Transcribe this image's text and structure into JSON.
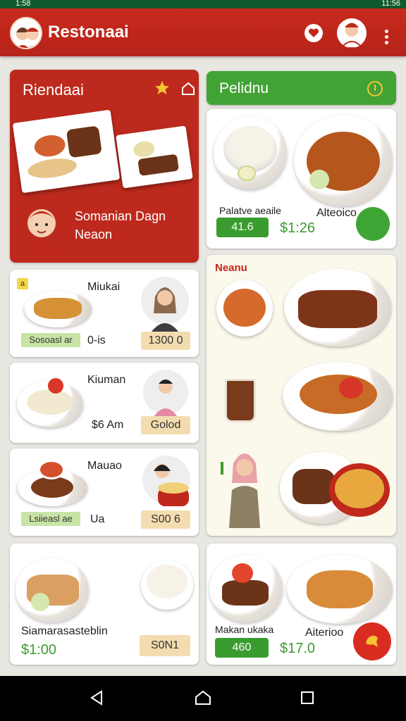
{
  "status": {
    "left": "1:58",
    "right": "11:56"
  },
  "app": {
    "title": "Restonaai"
  },
  "feature": {
    "title": "Riendaai",
    "subtitle_line1": "Somanian Dagn",
    "subtitle_line2": "Neaon"
  },
  "pelidnu": {
    "title": "Pelidnu",
    "left_label": "Palatve aeaile",
    "right_label": "Alteoico",
    "pill": "41.6",
    "price": "$1:26"
  },
  "list": [
    {
      "badge": "a",
      "name": "Miukai",
      "pill": "Sosoasl ar",
      "meta": "0-is",
      "price": "1300 0"
    },
    {
      "name": "Kiuman",
      "meta": "$6 Am",
      "price": "Golod"
    },
    {
      "name": "Mauao",
      "pill": "Lsiieasl ae",
      "meta": "Ua",
      "price": "S00 6"
    }
  ],
  "menu_panel": {
    "title": "Neanu"
  },
  "bottom_left": {
    "title": "Siamarasasteblin",
    "price": "$1:00",
    "tag": "S0N1"
  },
  "bottom_right": {
    "left_label": "Makan ukaka",
    "right_label": "Aiterioo",
    "pill": "460",
    "price": "$17.0"
  },
  "colors": {
    "appbar": "#c0281b",
    "accent_green": "#3a9c2f",
    "price_tag": "#f3ddb0",
    "status_bar": "#0f5a2c"
  }
}
